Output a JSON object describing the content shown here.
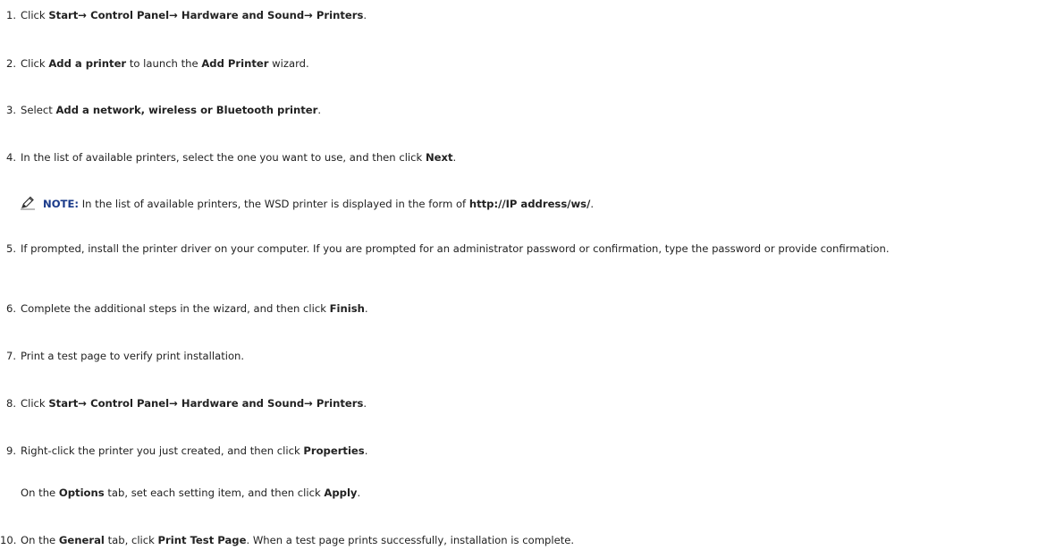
{
  "steps": [
    {
      "number": "1.",
      "parts": [
        {
          "text": "Click "
        },
        {
          "text": "Start",
          "bold": true
        },
        {
          "text": "→ ",
          "bold": true
        },
        {
          "text": "Control Panel",
          "bold": true
        },
        {
          "text": "→ ",
          "bold": true
        },
        {
          "text": "Hardware and Sound",
          "bold": true
        },
        {
          "text": "→ ",
          "bold": true
        },
        {
          "text": "Printers",
          "bold": true
        },
        {
          "text": "."
        }
      ]
    },
    {
      "number": "2.",
      "parts": [
        {
          "text": "Click "
        },
        {
          "text": "Add a printer",
          "bold": true
        },
        {
          "text": " to launch the "
        },
        {
          "text": "Add Printer",
          "bold": true
        },
        {
          "text": " wizard."
        }
      ]
    },
    {
      "number": "3.",
      "parts": [
        {
          "text": "Select "
        },
        {
          "text": "Add a network, wireless or Bluetooth printer",
          "bold": true
        },
        {
          "text": "."
        }
      ]
    },
    {
      "number": "4.",
      "parts": [
        {
          "text": "In the list of available printers, select the one you want to use, and then click "
        },
        {
          "text": "Next",
          "bold": true
        },
        {
          "text": "."
        }
      ]
    },
    {
      "number": "5.",
      "parts": [
        {
          "text": "If prompted, install the printer driver on your computer. If you are prompted for an administrator password or confirmation, type the password or provide confirmation."
        }
      ]
    },
    {
      "number": "6.",
      "parts": [
        {
          "text": "Complete the additional steps in the wizard, and then click "
        },
        {
          "text": "Finish",
          "bold": true
        },
        {
          "text": "."
        }
      ]
    },
    {
      "number": "7.",
      "parts": [
        {
          "text": "Print a test page to verify print installation."
        }
      ]
    },
    {
      "number": "8.",
      "parts": [
        {
          "text": "Click "
        },
        {
          "text": "Start",
          "bold": true
        },
        {
          "text": "→ ",
          "bold": true
        },
        {
          "text": "Control Panel",
          "bold": true
        },
        {
          "text": "→ ",
          "bold": true
        },
        {
          "text": "Hardware and Sound",
          "bold": true
        },
        {
          "text": "→ ",
          "bold": true
        },
        {
          "text": "Printers",
          "bold": true
        },
        {
          "text": "."
        }
      ]
    },
    {
      "number": "9.",
      "parts": [
        {
          "text": "Right-click the printer you just created, and then click "
        },
        {
          "text": "Properties",
          "bold": true
        },
        {
          "text": "."
        }
      ]
    },
    {
      "number": "10.",
      "parts": [
        {
          "text": "On the "
        },
        {
          "text": "General",
          "bold": true
        },
        {
          "text": " tab, click "
        },
        {
          "text": "Print Test Page",
          "bold": true
        },
        {
          "text": ". When a test page prints successfully, installation is complete."
        }
      ]
    }
  ],
  "note": {
    "icon": "note-pencil-icon",
    "label": "NOTE:",
    "parts": [
      {
        "text": " In the list of available printers, the WSD printer is displayed in the form of "
      },
      {
        "text": "http://IP address/ws/",
        "bold": true
      },
      {
        "text": "."
      }
    ]
  },
  "sub_step": {
    "parts": [
      {
        "text": "On the "
      },
      {
        "text": "Options",
        "bold": true
      },
      {
        "text": " tab, set each setting item, and then click "
      },
      {
        "text": "Apply",
        "bold": true
      },
      {
        "text": "."
      }
    ]
  },
  "colors": {
    "text": "#222222",
    "note_label": "#1a3a8a",
    "background": "#ffffff"
  }
}
